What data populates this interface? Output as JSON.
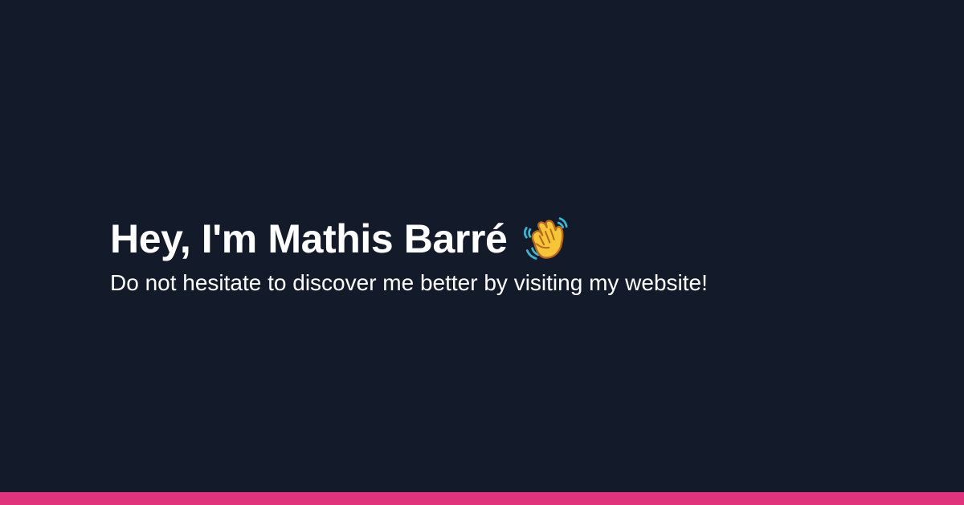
{
  "greeting": {
    "title": "Hey, I'm Mathis Barré",
    "icon": "waving-hand-icon"
  },
  "subtitle": "Do not hesitate to discover me better by visiting my website!",
  "colors": {
    "background": "#131a29",
    "text": "#ffffff",
    "accent": "#e0337c",
    "hand": "#f6c638",
    "hand_outline": "#b7691d",
    "wave_lines": "#36b8d7"
  }
}
